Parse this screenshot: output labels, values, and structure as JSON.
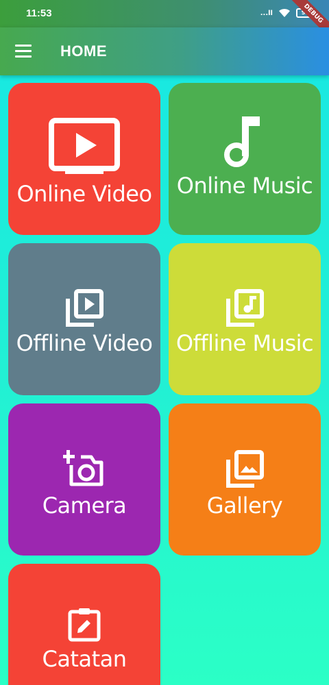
{
  "status_bar": {
    "time": "11:53",
    "signal_text": "...ll",
    "battery": "96",
    "debug_label": "DEBUG"
  },
  "app_bar": {
    "title": "HOME",
    "menu_icon": "menu-icon"
  },
  "tiles": [
    {
      "label": "Online Video",
      "icon": "ondemand-video-icon",
      "color": "#F44336"
    },
    {
      "label": "Online Music",
      "icon": "music-note-icon",
      "color": "#4CAF50"
    },
    {
      "label": "Offline Video",
      "icon": "video-library-icon",
      "color": "#607D8B"
    },
    {
      "label": "Offline Music",
      "icon": "library-music-icon",
      "color": "#CDDC39"
    },
    {
      "label": "Camera",
      "icon": "add-a-photo-icon",
      "color": "#9C27B0"
    },
    {
      "label": "Gallery",
      "icon": "photo-library-icon",
      "color": "#F57F17"
    },
    {
      "label": "Catatan",
      "icon": "assignment-edit-icon",
      "color": "#F44336"
    }
  ],
  "colors": {
    "background_top": "#17E7E4",
    "background_bottom": "#2BFFC6",
    "appbar_left": "#47A94F",
    "appbar_right": "#2A8FE2"
  }
}
